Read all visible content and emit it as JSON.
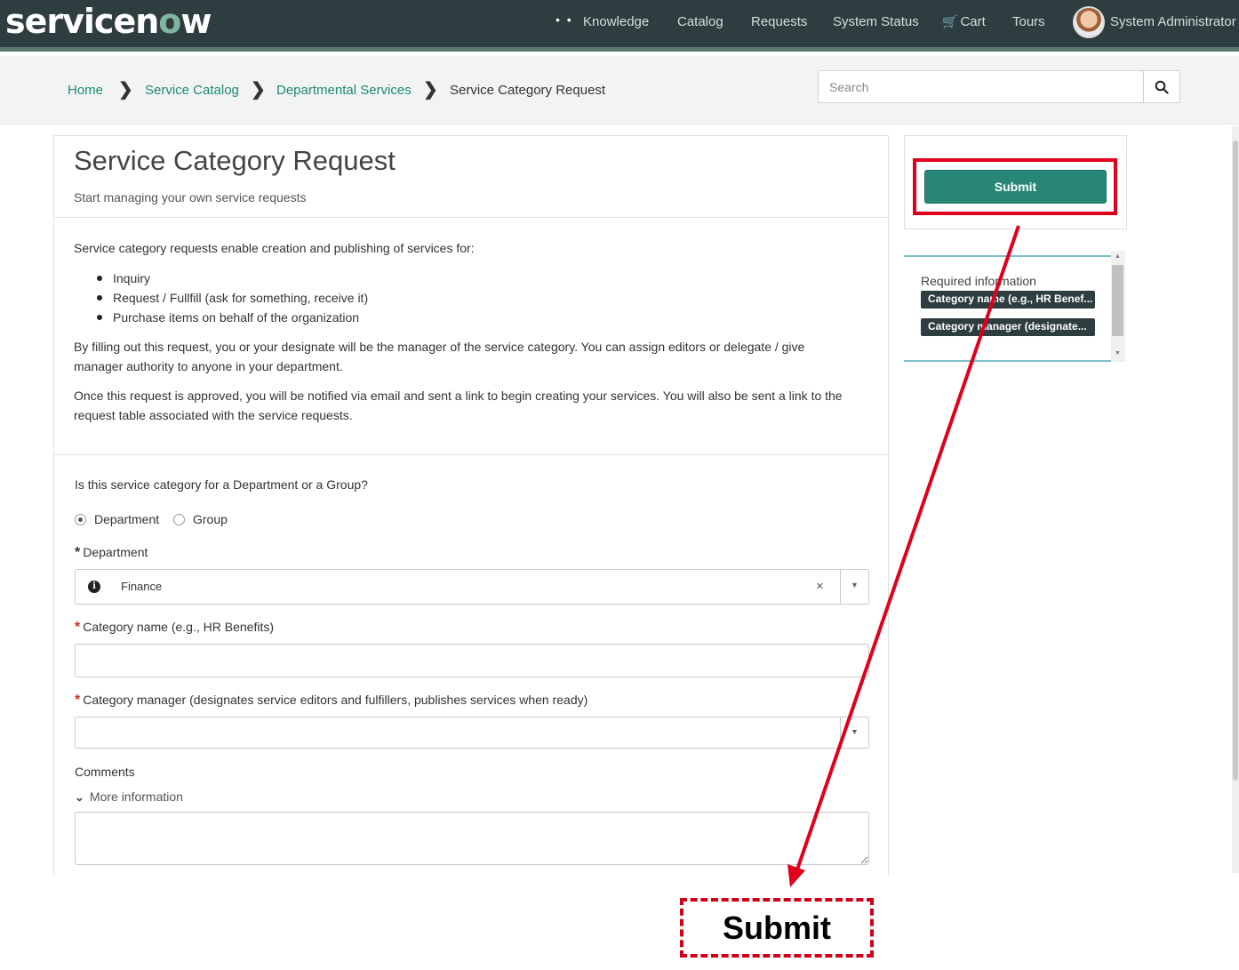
{
  "brand": {
    "logo_pre": "servicen",
    "logo_o": "o",
    "logo_post": "w"
  },
  "nav": {
    "dots": "• •",
    "items": [
      "Knowledge",
      "Catalog",
      "Requests",
      "System Status",
      "Cart",
      "Tours"
    ],
    "user": "System Administrator"
  },
  "breadcrumb": {
    "items": [
      "Home",
      "Service Catalog",
      "Departmental Services",
      "Service Category Request"
    ],
    "separator": "❯"
  },
  "search": {
    "placeholder": "Search",
    "icon": "magnifier-icon"
  },
  "form": {
    "title": "Service Category Request",
    "subtitle": "Start managing your own service requests",
    "intro": "Service category requests enable creation and publishing of services for:",
    "bullets": [
      "Inquiry",
      "Request / Fullfill (ask for something, receive it)",
      "Purchase items on behalf of the organization"
    ],
    "para1_line1": "By filling out this request, you or your designate will be the manager of the service category. You can assign editors or delegate / give",
    "para1_line2": "manager authority to anyone in your department.",
    "para2_line1": "Once this request is approved, you will be notified via email and sent a link to begin creating your services. You will also be sent a link to the",
    "para2_line2": "request table associated with the service requests.",
    "question": "Is this service category for a Department or a Group?",
    "radio_options": [
      "Department",
      "Group"
    ],
    "radio_selected": "Department",
    "required_mark": "*",
    "department_label": "Department",
    "department_value": "Finance",
    "clear_glyph": "×",
    "caret_glyph": "▼",
    "category_name_label": "Category name (e.g., HR Benefits)",
    "category_manager_label": "Category manager (designates service editors and fulfillers, publishes services when ready)",
    "comments_label": "Comments",
    "more_info": "More information"
  },
  "sidebar": {
    "submit_label": "Submit",
    "required_title": "Required information",
    "required_items": [
      "Category name (e.g., HR Benef...",
      "Category manager (designate..."
    ]
  },
  "annotation": {
    "callout_text": "Submit",
    "color": "#e0001b"
  },
  "colors": {
    "nav_bg": "#2e3d3f",
    "accent": "#278676",
    "link": "#1e8a74"
  }
}
